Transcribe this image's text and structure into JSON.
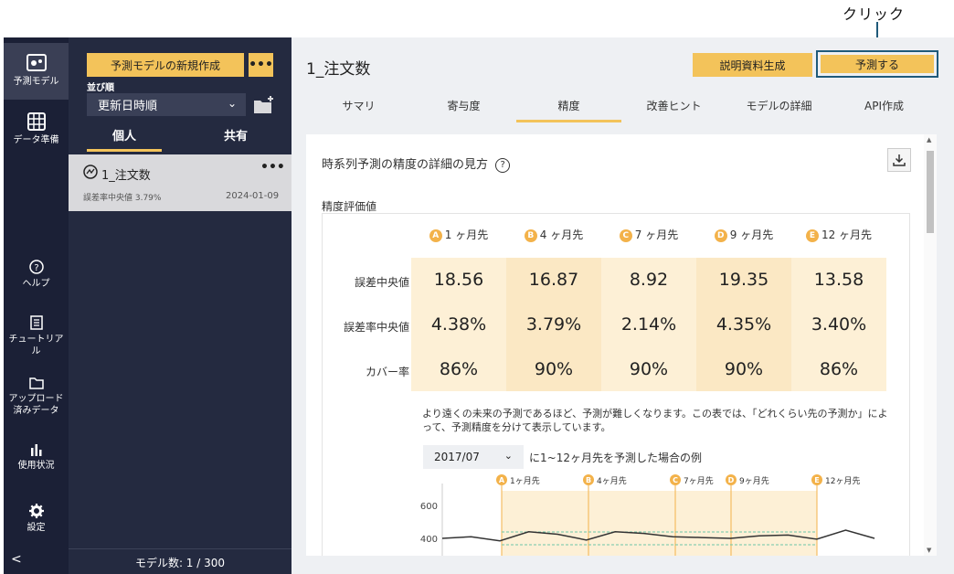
{
  "annotation": {
    "label": "クリック"
  },
  "nav": {
    "items": [
      {
        "label": "予測モデル",
        "icon": "model-icon"
      },
      {
        "label": "データ準備",
        "icon": "table-icon"
      },
      {
        "label": "ヘルプ",
        "icon": "help-icon"
      },
      {
        "label": "チュートリアル",
        "icon": "document-icon"
      },
      {
        "label": "アップロード済みデータ",
        "icon": "folder-icon"
      },
      {
        "label": "使用状況",
        "icon": "bar-chart-icon"
      },
      {
        "label": "設定",
        "icon": "gear-icon"
      }
    ],
    "collapse": "<"
  },
  "panel": {
    "new_model_button": "予測モデルの新規作成",
    "more_button": "•••",
    "sort_label": "並び順",
    "sort_value": "更新日時順",
    "tabs": {
      "personal": "個人",
      "shared": "共有"
    },
    "model": {
      "name": "1_注文数",
      "metric": "誤差率中央値 3.79%",
      "date": "2024-01-09",
      "more": "•••"
    },
    "model_count": "モデル数: 1 / 300"
  },
  "main": {
    "title": "1_注文数",
    "doc_button": "説明資料生成",
    "predict_button": "予測する",
    "tabs": [
      "サマリ",
      "寄与度",
      "精度",
      "改善ヒント",
      "モデルの詳細",
      "API作成"
    ],
    "active_tab": "精度",
    "card_title": "時系列予測の精度の詳細の見方",
    "help_mark": "?",
    "section_label": "精度評価値",
    "columns": [
      {
        "badge": "A",
        "label": "1 ヶ月先"
      },
      {
        "badge": "B",
        "label": "4 ヶ月先"
      },
      {
        "badge": "C",
        "label": "7 ヶ月先"
      },
      {
        "badge": "D",
        "label": "9 ヶ月先"
      },
      {
        "badge": "E",
        "label": "12 ヶ月先"
      }
    ],
    "rows": [
      {
        "label": "誤差中央値",
        "values": [
          "18.56",
          "16.87",
          "8.92",
          "19.35",
          "13.58"
        ]
      },
      {
        "label": "誤差率中央値",
        "values": [
          "4.38%",
          "3.79%",
          "2.14%",
          "4.35%",
          "3.40%"
        ]
      },
      {
        "label": "カバー率",
        "values": [
          "86%",
          "90%",
          "90%",
          "90%",
          "86%"
        ]
      }
    ],
    "note": "より遠くの未来の予測であるほど、予測が難しくなります。この表では、「どれくらい先の予測か」によって、予測精度を分けて表示しています。",
    "month_select": "2017/07",
    "month_suffix": "に1~12ヶ月先を予測した場合の例",
    "colors": {
      "accent": "#f3c35a",
      "sidebar": "#1b2036",
      "highlight": "#1f5a7a"
    }
  },
  "chart_data": {
    "type": "line",
    "markers": [
      {
        "badge": "A",
        "label": "1ヶ月先"
      },
      {
        "badge": "B",
        "label": "4ヶ月先"
      },
      {
        "badge": "C",
        "label": "7ヶ月先"
      },
      {
        "badge": "D",
        "label": "9ヶ月先"
      },
      {
        "badge": "E",
        "label": "12ヶ月先"
      }
    ],
    "yticks": [
      "600",
      "400"
    ],
    "ylim": [
      300,
      650
    ],
    "series": [
      {
        "values": [
          400,
          410,
          385,
          440,
          425,
          390,
          440,
          430,
          410,
          405,
          400,
          415,
          420,
          395,
          450,
          400
        ]
      }
    ]
  }
}
